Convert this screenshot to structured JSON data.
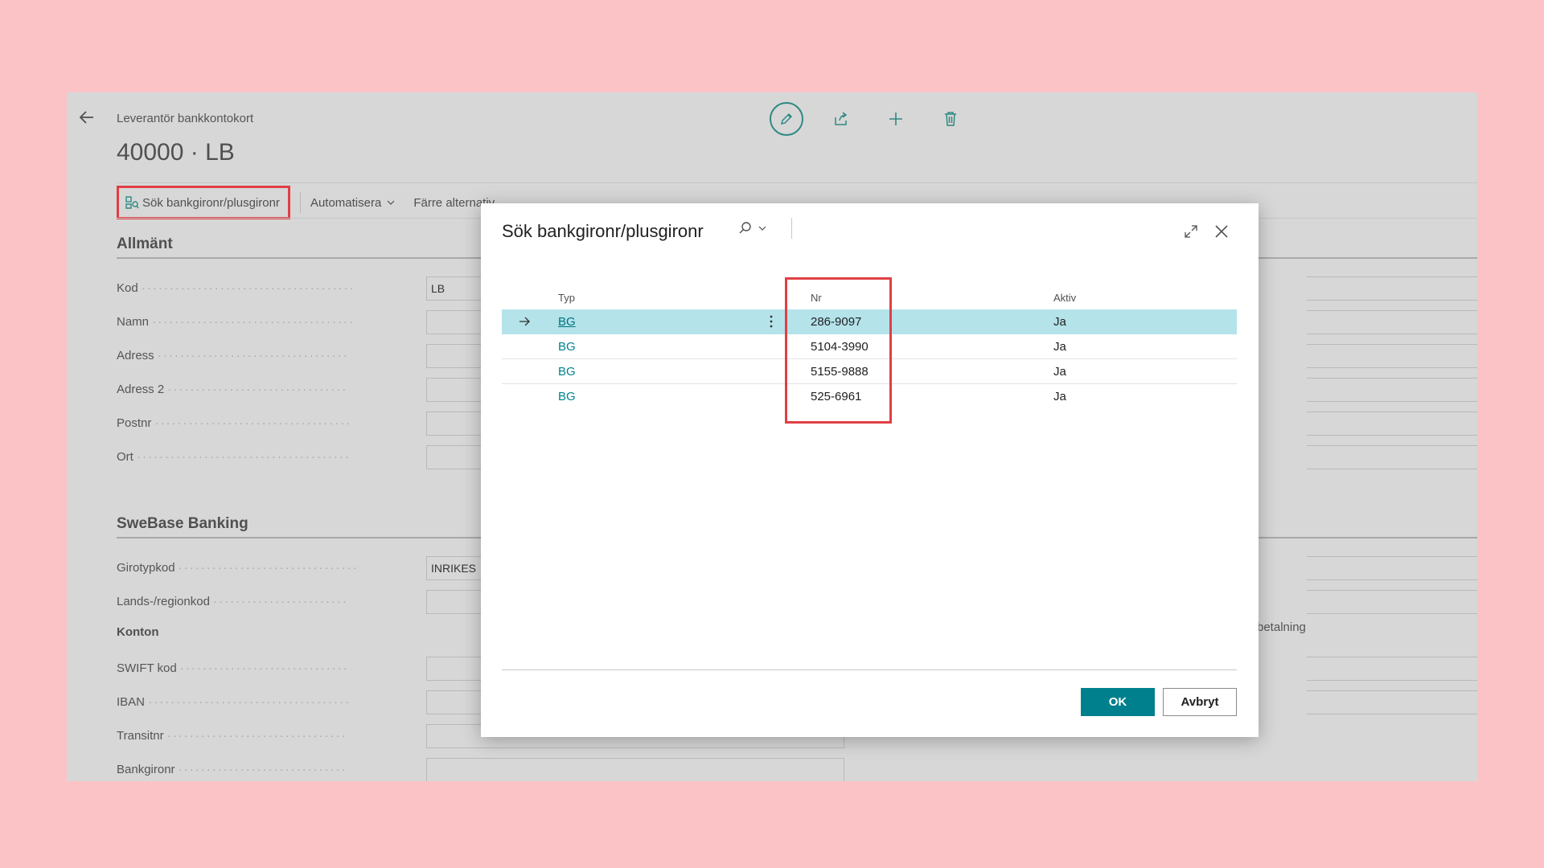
{
  "page": {
    "breadcrumb": "Leverantör bankkontokort",
    "title": "40000 · LB",
    "actions": {
      "search": "Sök bankgironr/plusgironr",
      "automate": "Automatisera",
      "fewer": "Färre alternativ"
    },
    "general": {
      "title": "Allmänt",
      "fields": [
        {
          "label": "Kod",
          "value": "LB"
        },
        {
          "label": "Namn",
          "value": ""
        },
        {
          "label": "Adress",
          "value": ""
        },
        {
          "label": "Adress 2",
          "value": ""
        },
        {
          "label": "Postnr",
          "value": ""
        },
        {
          "label": "Ort",
          "value": ""
        }
      ]
    },
    "swebase": {
      "title": "SweBase Banking",
      "fields": [
        {
          "label": "Girotypkod",
          "value": "INRIKES"
        },
        {
          "label": "Lands-/regionkod",
          "value": ""
        }
      ],
      "konton_title": "Konton",
      "konton_fields": [
        {
          "label": "SWIFT kod",
          "value": ""
        },
        {
          "label": "IBAN",
          "value": ""
        },
        {
          "label": "Transitnr",
          "value": ""
        },
        {
          "label": "Bankgironr",
          "value": ""
        }
      ],
      "right_partial_text": "betalning"
    }
  },
  "dialog": {
    "title": "Sök bankgironr/plusgironr",
    "columns": {
      "typ": "Typ",
      "nr": "Nr",
      "aktiv": "Aktiv"
    },
    "rows": [
      {
        "typ": "BG",
        "nr": "286-9097",
        "aktiv": "Ja",
        "selected": true
      },
      {
        "typ": "BG",
        "nr": "5104-3990",
        "aktiv": "Ja",
        "selected": false
      },
      {
        "typ": "BG",
        "nr": "5155-9888",
        "aktiv": "Ja",
        "selected": false
      },
      {
        "typ": "BG",
        "nr": "525-6961",
        "aktiv": "Ja",
        "selected": false
      }
    ],
    "ok": "OK",
    "cancel": "Avbryt"
  },
  "colors": {
    "background": "#fbc3c6",
    "accent": "#00808d",
    "highlight": "#e03f45",
    "selected_row": "#b4e3ea"
  }
}
